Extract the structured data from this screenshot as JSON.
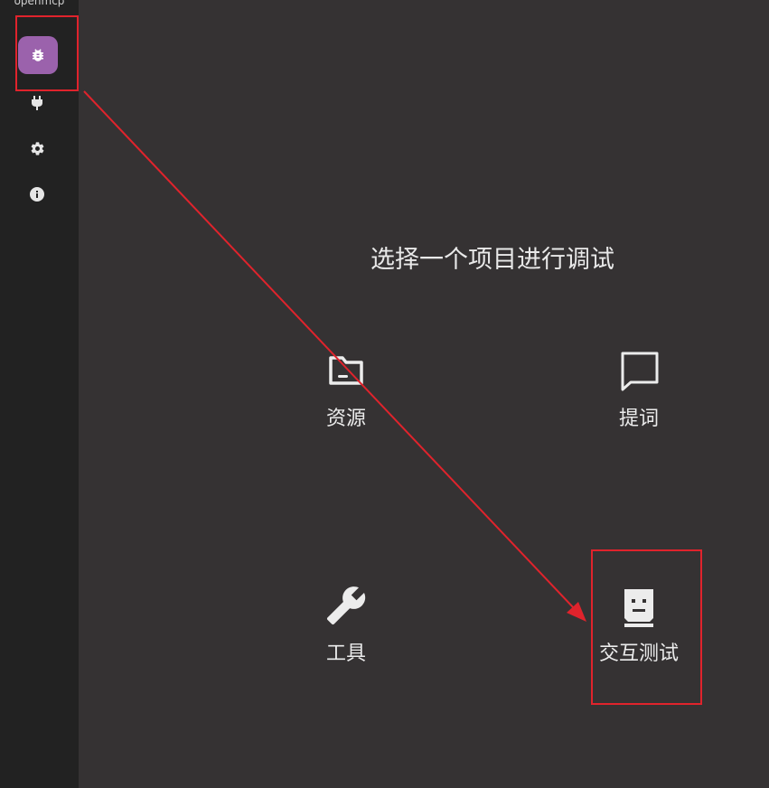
{
  "sidebar": {
    "app_name": "openmcp",
    "items": [
      {
        "icon": "bug-icon",
        "active": true
      },
      {
        "icon": "plug-icon",
        "active": false
      },
      {
        "icon": "gear-icon",
        "active": false
      },
      {
        "icon": "info-icon",
        "active": false
      }
    ]
  },
  "main": {
    "title": "选择一个项目进行调试",
    "options": [
      {
        "label": "资源",
        "icon": "folder-icon"
      },
      {
        "label": "提词",
        "icon": "chat-bubble-icon"
      },
      {
        "label": "工具",
        "icon": "wrench-icon"
      },
      {
        "label": "交互测试",
        "icon": "robot-face-icon"
      }
    ]
  },
  "colors": {
    "sidebar_bg": "#222222",
    "main_bg": "#353233",
    "accent": "#9b62ac",
    "annotation": "#e0232c"
  }
}
